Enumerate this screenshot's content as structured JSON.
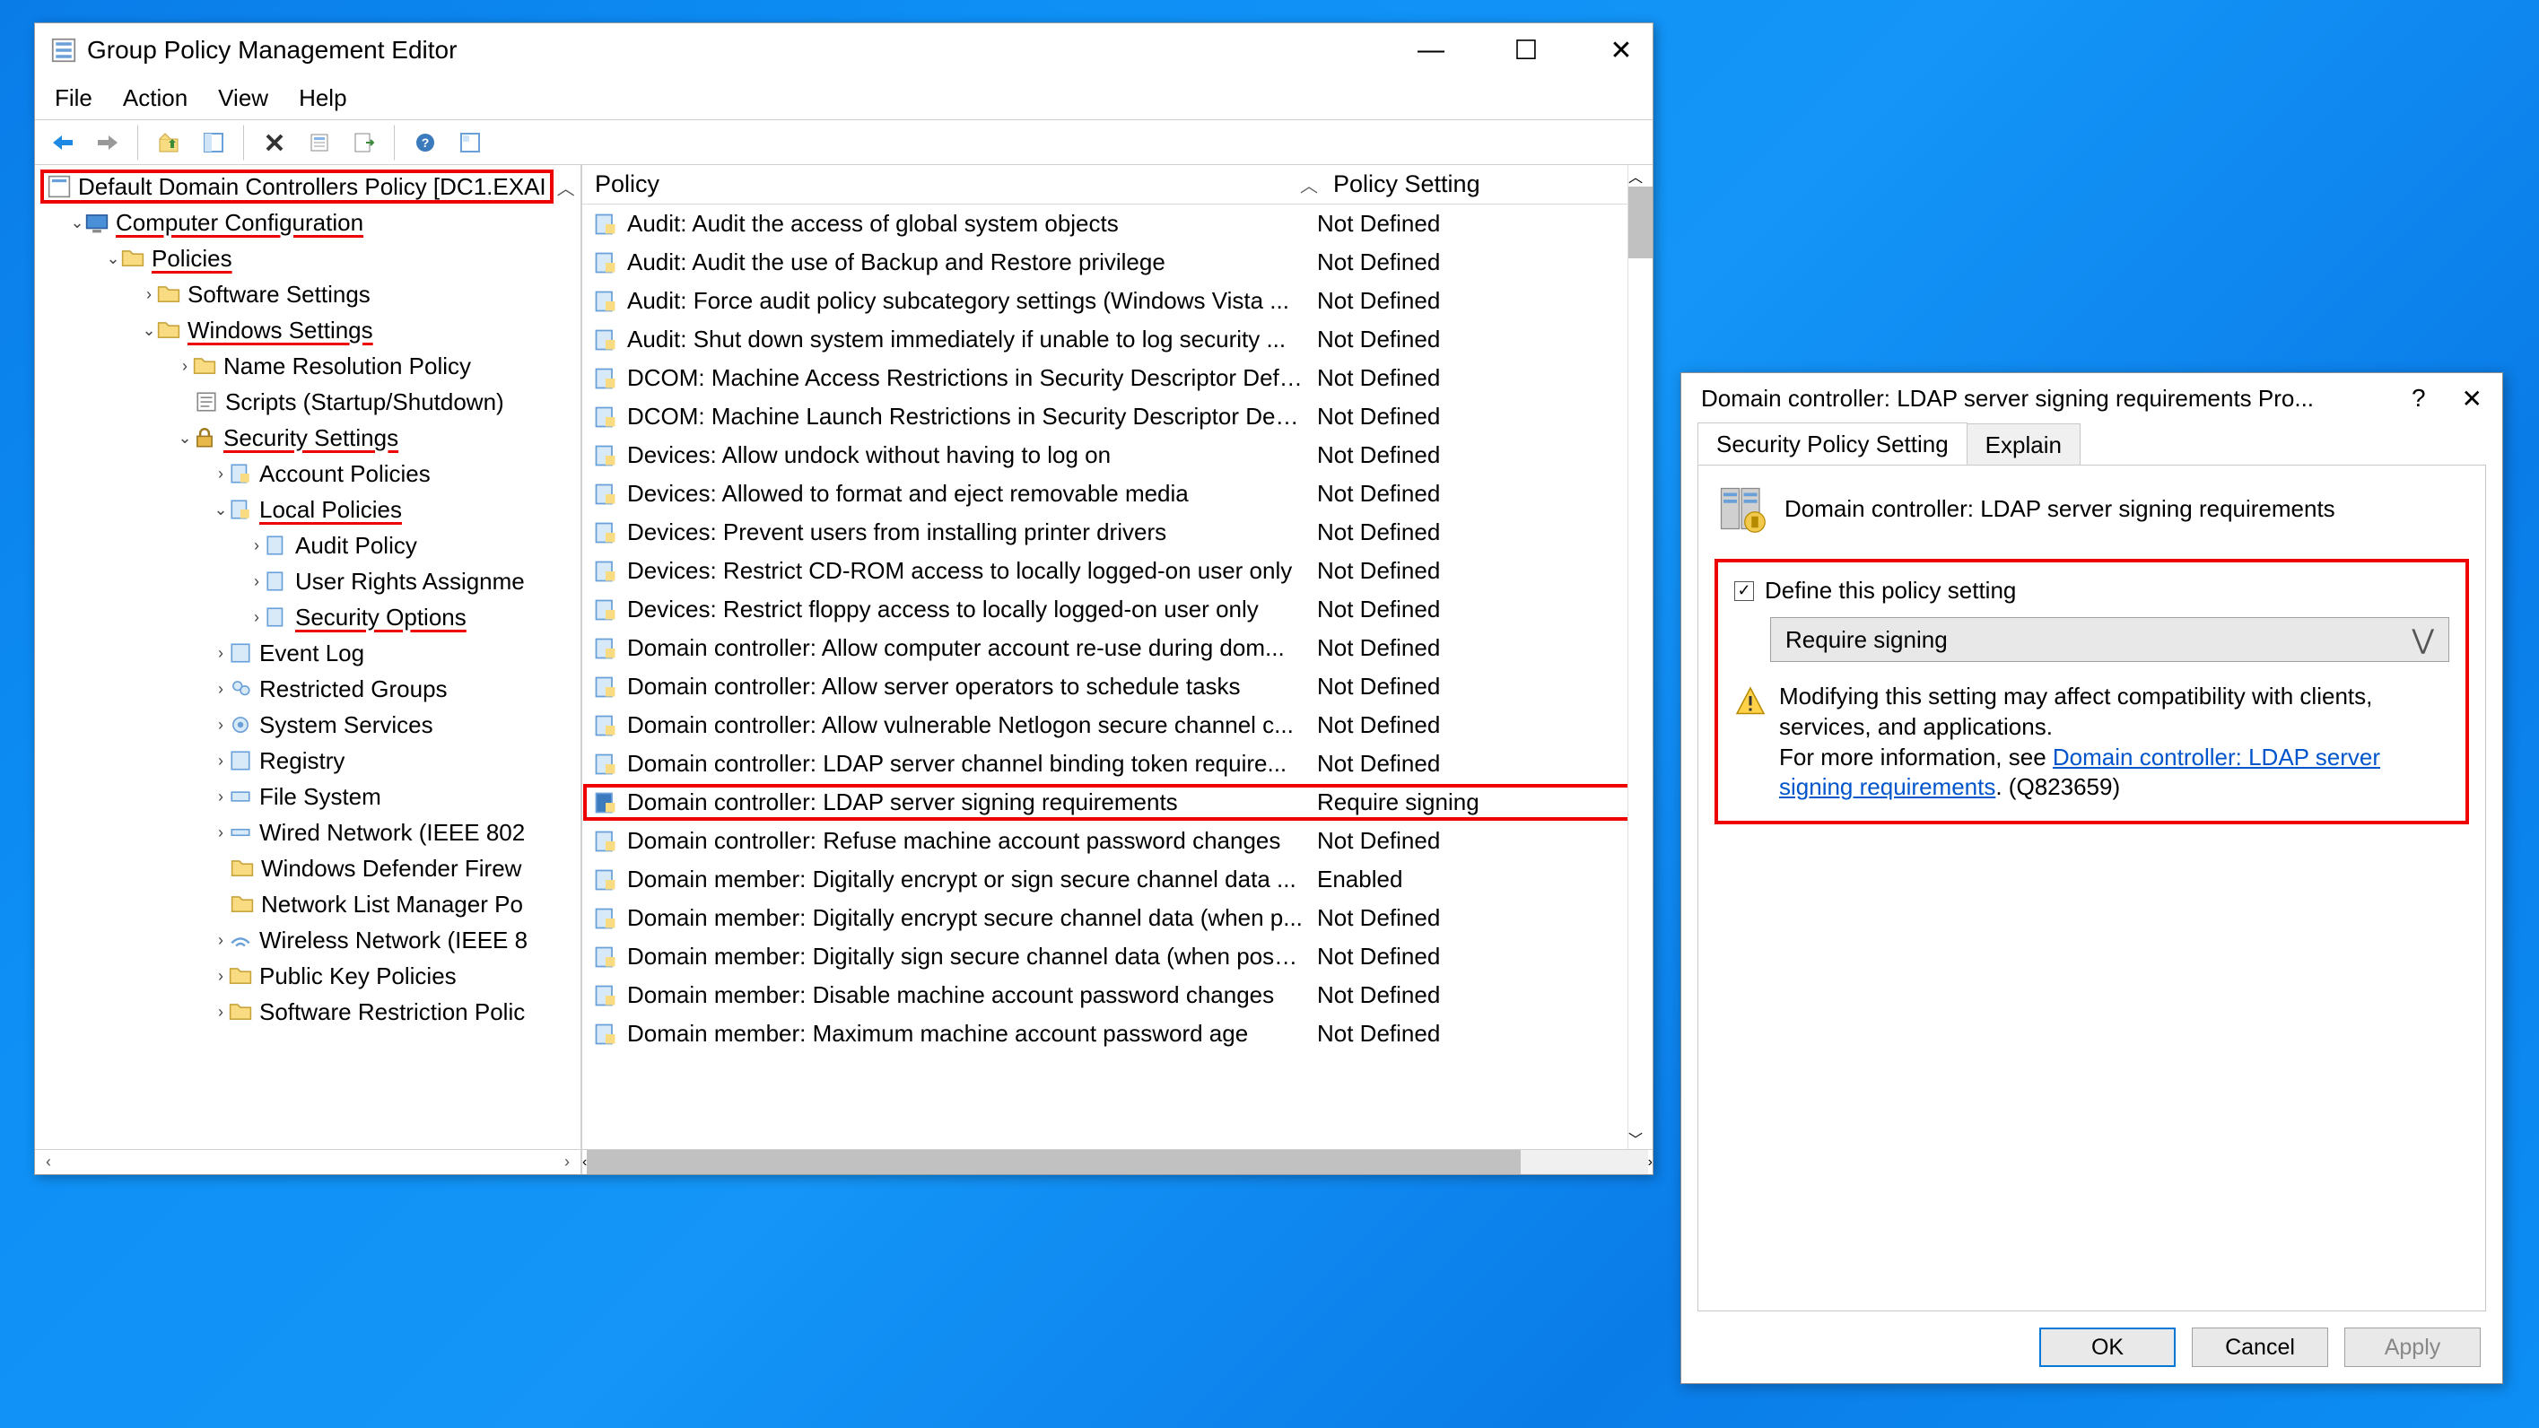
{
  "editor": {
    "title": "Group Policy Management Editor",
    "menu": [
      "File",
      "Action",
      "View",
      "Help"
    ],
    "tree": {
      "root": "Default Domain Controllers Policy [DC1.EXAI",
      "computer_config": "Computer Configuration",
      "policies": "Policies",
      "software_settings": "Software Settings",
      "windows_settings": "Windows Settings",
      "name_resolution": "Name Resolution Policy",
      "scripts": "Scripts (Startup/Shutdown)",
      "security_settings": "Security Settings",
      "account_policies": "Account Policies",
      "local_policies": "Local Policies",
      "audit_policy": "Audit Policy",
      "user_rights": "User Rights Assignme",
      "security_options": "Security Options",
      "event_log": "Event Log",
      "restricted_groups": "Restricted Groups",
      "system_services": "System Services",
      "registry": "Registry",
      "file_system": "File System",
      "wired_network": "Wired Network (IEEE 802",
      "defender": "Windows Defender Firew",
      "network_list": "Network List Manager Po",
      "wireless": "Wireless Network (IEEE 8",
      "pki": "Public Key Policies",
      "srp": "Software Restriction Polic"
    },
    "columns": {
      "policy": "Policy",
      "setting": "Policy Setting"
    },
    "rows": [
      {
        "name": "Audit: Audit the access of global system objects",
        "setting": "Not Defined"
      },
      {
        "name": "Audit: Audit the use of Backup and Restore privilege",
        "setting": "Not Defined"
      },
      {
        "name": "Audit: Force audit policy subcategory settings (Windows Vista ...",
        "setting": "Not Defined"
      },
      {
        "name": "Audit: Shut down system immediately if unable to log security ...",
        "setting": "Not Defined"
      },
      {
        "name": "DCOM: Machine Access Restrictions in Security Descriptor Defin...",
        "setting": "Not Defined"
      },
      {
        "name": "DCOM: Machine Launch Restrictions in Security Descriptor Defi...",
        "setting": "Not Defined"
      },
      {
        "name": "Devices: Allow undock without having to log on",
        "setting": "Not Defined"
      },
      {
        "name": "Devices: Allowed to format and eject removable media",
        "setting": "Not Defined"
      },
      {
        "name": "Devices: Prevent users from installing printer drivers",
        "setting": "Not Defined"
      },
      {
        "name": "Devices: Restrict CD-ROM access to locally logged-on user only",
        "setting": "Not Defined"
      },
      {
        "name": "Devices: Restrict floppy access to locally logged-on user only",
        "setting": "Not Defined"
      },
      {
        "name": "Domain controller: Allow computer account re-use during dom...",
        "setting": "Not Defined"
      },
      {
        "name": "Domain controller: Allow server operators to schedule tasks",
        "setting": "Not Defined"
      },
      {
        "name": "Domain controller: Allow vulnerable Netlogon secure channel c...",
        "setting": "Not Defined"
      },
      {
        "name": "Domain controller: LDAP server channel binding token require...",
        "setting": "Not Defined"
      },
      {
        "name": "Domain controller: LDAP server signing requirements",
        "setting": "Require signing",
        "hl": true,
        "blue": true
      },
      {
        "name": "Domain controller: Refuse machine account password changes",
        "setting": "Not Defined"
      },
      {
        "name": "Domain member: Digitally encrypt or sign secure channel data ...",
        "setting": "Enabled"
      },
      {
        "name": "Domain member: Digitally encrypt secure channel data (when p...",
        "setting": "Not Defined"
      },
      {
        "name": "Domain member: Digitally sign secure channel data (when poss...",
        "setting": "Not Defined"
      },
      {
        "name": "Domain member: Disable machine account password changes",
        "setting": "Not Defined"
      },
      {
        "name": "Domain member: Maximum machine account password age",
        "setting": "Not Defined"
      }
    ]
  },
  "dialog": {
    "title": "Domain controller: LDAP server signing requirements Pro...",
    "tabs": {
      "security": "Security Policy Setting",
      "explain": "Explain"
    },
    "policy_name": "Domain controller: LDAP server signing requirements",
    "define_label": "Define this policy setting",
    "dropdown_value": "Require signing",
    "warn1": "Modifying this setting may affect compatibility with clients, services, and applications.",
    "warn2a": "For more information, see ",
    "warn_link": "Domain controller: LDAP server signing requirements",
    "warn2b": ". (Q823659)",
    "buttons": {
      "ok": "OK",
      "cancel": "Cancel",
      "apply": "Apply"
    }
  }
}
